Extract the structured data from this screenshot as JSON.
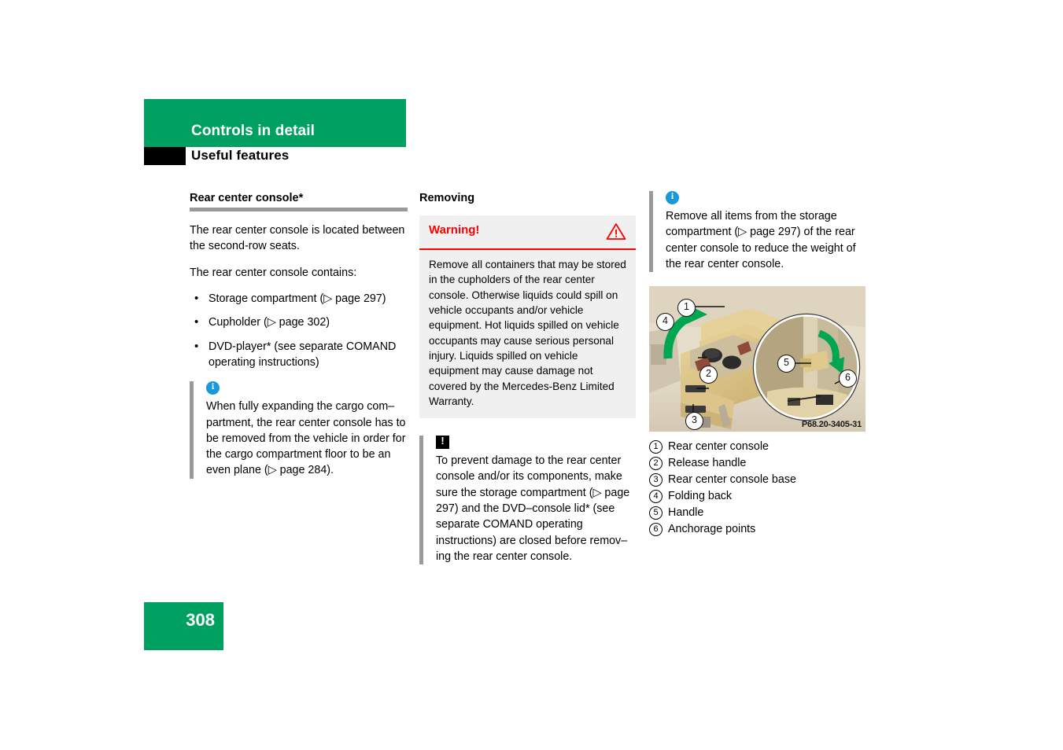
{
  "header": {
    "banner_title": "Controls in detail",
    "subtitle": "Useful features"
  },
  "left_column": {
    "heading": "Rear center console*",
    "paragraph_1": "The rear center console is located between the second-row seats.",
    "paragraph_2": "The rear center console contains:",
    "bullets": [
      "Storage compartment (▷ page 297)",
      "Cupholder (▷ page 302)",
      "DVD-player* (see separate COMAND operating instructions)"
    ],
    "note": {
      "icon": "info-icon",
      "text": "When fully expanding the cargo com–partment, the rear center console has to be removed from the vehicle in order for the cargo compartment floor to be an even plane (▷ page 284)."
    }
  },
  "middle_column": {
    "heading": "Removing",
    "warning": {
      "title": "Warning!",
      "icon": "warning-triangle-icon",
      "text": "Remove all containers that may be stored in the cupholders of the rear center console. Otherwise liquids could spill on vehicle occupants and/or vehicle equipment. Hot liquids spilled on vehicle occupants may cause serious personal injury. Liquids spilled on vehicle equipment may cause damage not covered by the Mercedes-Benz Limited Warranty."
    },
    "caution": {
      "icon": "caution-icon",
      "text": "To prevent damage to the rear center console and/or its components, make sure the storage compartment (▷ page 297) and the DVD–console lid* (see separate COMAND operating instructions) are closed before remov–ing the rear center console."
    }
  },
  "right_column": {
    "note": {
      "icon": "info-icon",
      "text": "Remove all items from the storage compartment (▷ page 297) of the rear center console to reduce the weight of the rear center console."
    },
    "figure": {
      "code": "P68.20-3405-31",
      "callouts": [
        "1",
        "2",
        "3",
        "4",
        "5",
        "6"
      ]
    },
    "legend": [
      {
        "num": "1",
        "label": "Rear center console"
      },
      {
        "num": "2",
        "label": "Release handle"
      },
      {
        "num": "3",
        "label": "Rear center console base"
      },
      {
        "num": "4",
        "label": "Folding back"
      },
      {
        "num": "5",
        "label": "Handle"
      },
      {
        "num": "6",
        "label": "Anchorage points"
      }
    ]
  },
  "footer": {
    "page_number": "308"
  },
  "colors": {
    "brand_green": "#00a160",
    "warning_red": "#ff0000",
    "info_blue": "#1799db",
    "rule_gray": "#9a9a9a",
    "warning_bg": "#f0f0f0"
  }
}
